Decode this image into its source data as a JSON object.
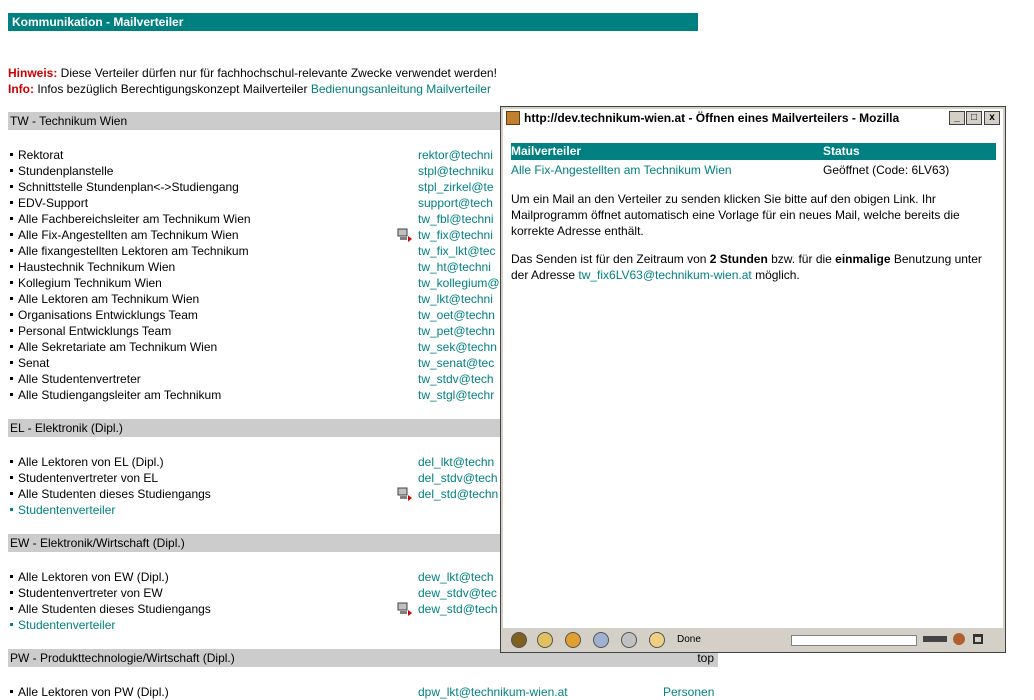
{
  "header": {
    "title": "Kommunikation - Mailverteiler"
  },
  "notes": {
    "hinweis_label": "Hinweis:",
    "hinweis_text": " Diese Verteiler dürfen nur für fachhochschul-relevante Zwecke verwendet werden!",
    "info_label": "Info:",
    "info_text": " Infos bezüglich Berechtigungskonzept Mailverteiler ",
    "info_link": "Bedienungsanleitung Mailverteiler"
  },
  "sections": {
    "tw": {
      "title": "TW - Technikum Wien"
    },
    "el": {
      "title": "EL - Elektronik (Dipl.)"
    },
    "ew": {
      "title": "EW - Elektronik/Wirtschaft (Dipl.)"
    },
    "pw": {
      "title": "PW - Produkttechnologie/Wirtschaft (Dipl.)",
      "top_link": "top"
    }
  },
  "tw_rows": [
    {
      "label": "Rektorat",
      "email": "rektor@techni"
    },
    {
      "label": "Stundenplanstelle",
      "email": "stpl@techniku"
    },
    {
      "label": "Schnittstelle Stundenplan<->Studiengang",
      "email": "stpl_zirkel@te"
    },
    {
      "label": "EDV-Support",
      "email": "support@tech"
    },
    {
      "label": "Alle Fachbereichsleiter am Technikum Wien",
      "email": "tw_fbl@techni"
    },
    {
      "label": "Alle Fix-Angestellten am Technikum Wien",
      "email": "tw_fix@techni"
    },
    {
      "label": "Alle fixangestellten Lektoren am Technikum",
      "email": "tw_fix_lkt@tec"
    },
    {
      "label": "Haustechnik Technikum Wien",
      "email": "tw_ht@techni"
    },
    {
      "label": "Kollegium Technikum Wien",
      "email": "tw_kollegium@"
    },
    {
      "label": "Alle Lektoren am Technikum Wien",
      "email": "tw_lkt@techni"
    },
    {
      "label": "Organisations Entwicklungs Team",
      "email": "tw_oet@techn"
    },
    {
      "label": "Personal Entwicklungs Team",
      "email": "tw_pet@techn"
    },
    {
      "label": "Alle Sekretariate am Technikum Wien",
      "email": "tw_sek@techn"
    },
    {
      "label": "Senat",
      "email": "tw_senat@tec"
    },
    {
      "label": "Alle Studentenvertreter",
      "email": "tw_stdv@tech"
    },
    {
      "label": "Alle Studiengangsleiter am Technikum",
      "email": "tw_stgl@techr"
    }
  ],
  "el_rows": [
    {
      "label": "Alle Lektoren von EL (Dipl.)",
      "email": "del_lkt@techn"
    },
    {
      "label": "Studentenvertreter von EL",
      "email": "del_stdv@tech"
    },
    {
      "label": "Alle Studenten dieses Studiengangs",
      "email": "del_std@techn"
    },
    {
      "label": "Studentenverteiler",
      "email": ""
    }
  ],
  "ew_rows": [
    {
      "label": "Alle Lektoren von EW (Dipl.)",
      "email": "dew_lkt@tech"
    },
    {
      "label": "Studentenvertreter von EW",
      "email": "dew_stdv@tec"
    },
    {
      "label": "Alle Studenten dieses Studiengangs",
      "email": "dew_std@tech"
    },
    {
      "label": "Studentenverteiler",
      "email": ""
    }
  ],
  "pw_rows": [
    {
      "label": "Alle Lektoren von PW (Dipl.)",
      "email": "dpw_lkt@technikum-wien.at",
      "extra": "Personen"
    }
  ],
  "popup": {
    "title": "http://dev.technikum-wien.at - Öffnen eines Mailverteilers - Mozilla",
    "col_verteiler": "Mailverteiler",
    "col_status": "Status",
    "verteiler_link": "Alle Fix-Angestellten am Technikum Wien",
    "status_value": "Geöffnet (Code: 6LV63)",
    "para1": "Um ein Mail an den Verteiler zu senden klicken Sie bitte auf den obigen Link. Ihr Mailprogramm öffnet automatisch eine Vorlage für ein neues Mail, welche bereits die korrekte Adresse enthält.",
    "para2_a": "Das Senden ist für den Zeitraum von ",
    "para2_b": "2 Stunden",
    "para2_c": " bzw. für die ",
    "para2_d": "einmalige",
    "para2_e": " Benutzung unter der Adresse ",
    "para2_link": "tw_fix6LV63@technikum-wien.at",
    "para2_f": " möglich.",
    "status_text": "Done",
    "progress": 0,
    "win_min": "_",
    "win_max": "□",
    "win_close": "x"
  }
}
